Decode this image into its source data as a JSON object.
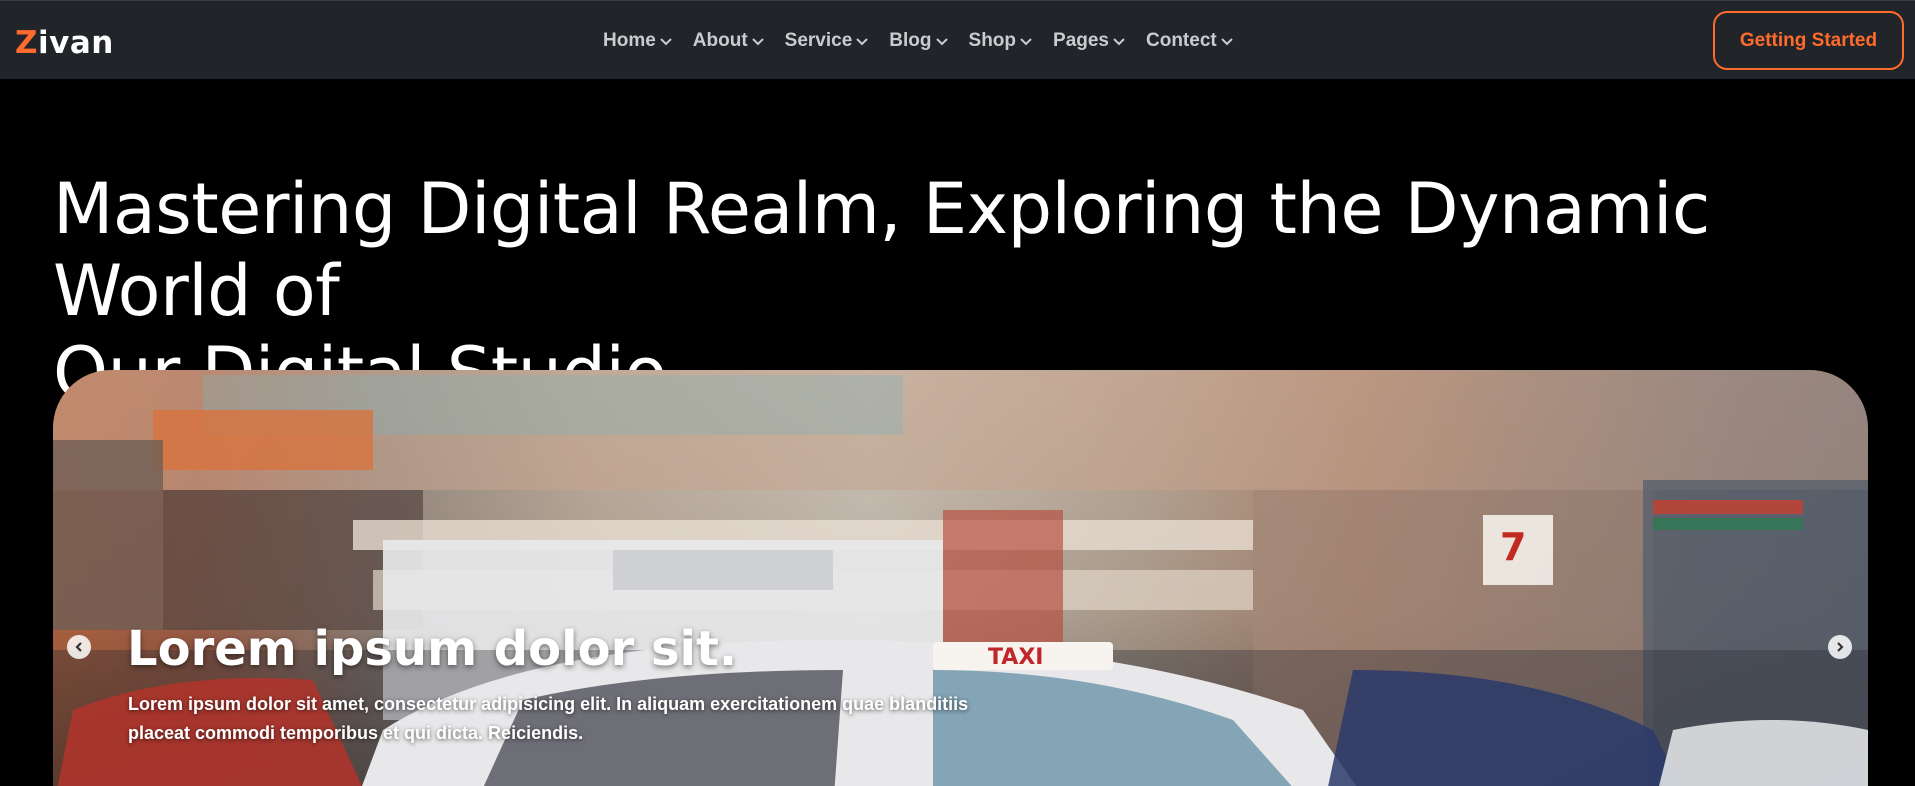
{
  "brand": {
    "first_letter": "Z",
    "rest": "ivan",
    "accent_color": "#ff6b2c"
  },
  "nav": {
    "items": [
      {
        "label": "Home"
      },
      {
        "label": "About"
      },
      {
        "label": "Service"
      },
      {
        "label": "Blog"
      },
      {
        "label": "Shop"
      },
      {
        "label": "Pages"
      },
      {
        "label": "Contect"
      }
    ],
    "chevron_icon": "chevron-down-icon"
  },
  "cta": {
    "label": "Getting Started"
  },
  "hero": {
    "title_line1": "Mastering Digital Realm, Exploring the Dynamic World of",
    "title_line2": "Our Digital Studio"
  },
  "slider": {
    "heading": "Lorem ipsum dolor sit.",
    "text_line1": "Lorem ipsum dolor sit amet, consectetur adipisicing elit. In aliquam exercitationem quae blanditiis",
    "text_line2": "placeat commodi temporibus et qui dicta. Reiciendis.",
    "prev_icon": "chevron-left-icon",
    "next_icon": "chevron-right-icon"
  },
  "colors": {
    "header_bg": "#212428",
    "page_bg": "#000000",
    "nav_text": "#c9cbcf"
  }
}
